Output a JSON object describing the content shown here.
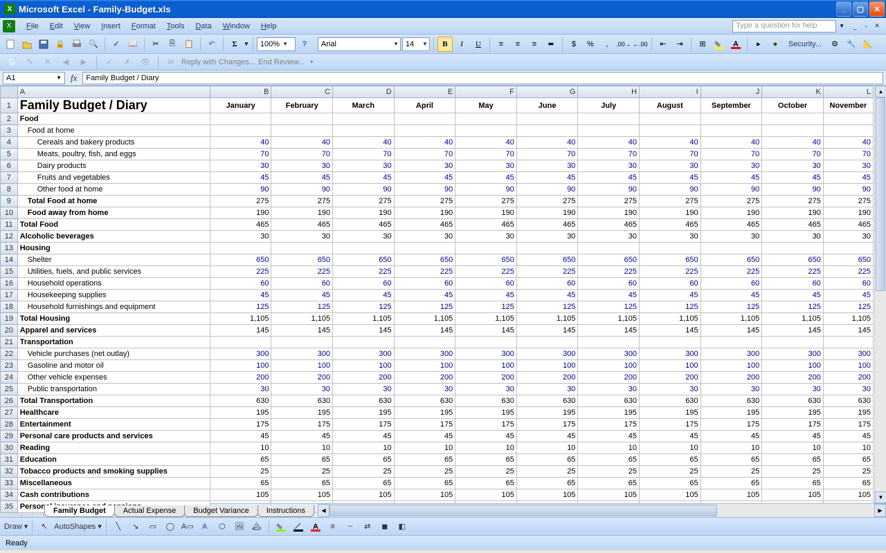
{
  "title": "Microsoft Excel - Family-Budget.xls",
  "menus": [
    "File",
    "Edit",
    "View",
    "Insert",
    "Format",
    "Tools",
    "Data",
    "Window",
    "Help"
  ],
  "helpPlaceholder": "Type a question for help",
  "zoom": "100%",
  "font": "Arial",
  "fontsize": "14",
  "review": {
    "reply": "Reply with Changes...",
    "end": "End Review..."
  },
  "namebox": "A1",
  "formula": "Family Budget / Diary",
  "columns": [
    "A",
    "B",
    "C",
    "D",
    "E",
    "F",
    "G",
    "H",
    "I",
    "J",
    "K",
    "L"
  ],
  "months": [
    "January",
    "February",
    "March",
    "April",
    "May",
    "June",
    "July",
    "August",
    "September",
    "October",
    "November"
  ],
  "rows": [
    {
      "n": 1,
      "title": true,
      "label": "Family Budget / Diary"
    },
    {
      "n": 2,
      "bold": true,
      "label": "Food"
    },
    {
      "n": 3,
      "indent": 1,
      "label": "Food at home"
    },
    {
      "n": 4,
      "indent": 2,
      "label": "Cereals and bakery products",
      "v": 40
    },
    {
      "n": 5,
      "indent": 2,
      "label": "Meats, poultry, fish, and eggs",
      "v": 70
    },
    {
      "n": 6,
      "indent": 2,
      "label": "Dairy products",
      "v": 30
    },
    {
      "n": 7,
      "indent": 2,
      "label": "Fruits and vegetables",
      "v": 45
    },
    {
      "n": 8,
      "indent": 2,
      "label": "Other food at home",
      "v": 90
    },
    {
      "n": 9,
      "indent": 1,
      "bold": true,
      "boldnum": true,
      "label": "Total Food at home",
      "v": 275
    },
    {
      "n": 10,
      "indent": 1,
      "bold": true,
      "label": "Food away from home",
      "v": 190
    },
    {
      "n": 11,
      "bold": true,
      "boldnum": true,
      "label": "Total Food",
      "v": 465
    },
    {
      "n": 12,
      "bold": true,
      "label": "Alcoholic beverages",
      "v": 30
    },
    {
      "n": 13,
      "bold": true,
      "label": "Housing"
    },
    {
      "n": 14,
      "indent": 1,
      "label": "Shelter",
      "v": 650
    },
    {
      "n": 15,
      "indent": 1,
      "label": "Utilities, fuels, and public services",
      "v": 225
    },
    {
      "n": 16,
      "indent": 1,
      "label": "Household operations",
      "v": 60
    },
    {
      "n": 17,
      "indent": 1,
      "label": "Housekeeping supplies",
      "v": 45
    },
    {
      "n": 18,
      "indent": 1,
      "label": "Household furnishings and equipment",
      "v": 125
    },
    {
      "n": 19,
      "bold": true,
      "boldnum": true,
      "label": "Total Housing",
      "v": "1,105"
    },
    {
      "n": 20,
      "bold": true,
      "label": "Apparel and services",
      "v": 145
    },
    {
      "n": 21,
      "bold": true,
      "label": "Transportation"
    },
    {
      "n": 22,
      "indent": 1,
      "label": "Vehicle purchases (net outlay)",
      "v": 300
    },
    {
      "n": 23,
      "indent": 1,
      "label": "Gasoline and motor oil",
      "v": 100
    },
    {
      "n": 24,
      "indent": 1,
      "label": "Other vehicle expenses",
      "v": 200
    },
    {
      "n": 25,
      "indent": 1,
      "label": "Public transportation",
      "v": 30
    },
    {
      "n": 26,
      "bold": true,
      "boldnum": true,
      "label": "Total Transportation",
      "v": 630
    },
    {
      "n": 27,
      "bold": true,
      "label": "Healthcare",
      "v": 195
    },
    {
      "n": 28,
      "bold": true,
      "label": "Entertainment",
      "v": 175
    },
    {
      "n": 29,
      "bold": true,
      "label": "Personal care products and services",
      "v": 45
    },
    {
      "n": 30,
      "bold": true,
      "label": "Reading",
      "v": 10
    },
    {
      "n": 31,
      "bold": true,
      "label": "Education",
      "v": 65
    },
    {
      "n": 32,
      "bold": true,
      "label": "Tobacco products and smoking supplies",
      "v": 25
    },
    {
      "n": 33,
      "bold": true,
      "label": "Miscellaneous",
      "v": 65
    },
    {
      "n": 34,
      "bold": true,
      "label": "Cash contributions",
      "v": 105
    },
    {
      "n": 35,
      "bold": true,
      "label": "Personal insurance and pensions",
      "partial": true
    }
  ],
  "sheetTabs": [
    "Family Budget",
    "Actual Expense",
    "Budget Variance",
    "Instructions"
  ],
  "activeTab": 0,
  "draw": {
    "label": "Draw",
    "autoshapes": "AutoShapes"
  },
  "security": "Security...",
  "status": "Ready"
}
